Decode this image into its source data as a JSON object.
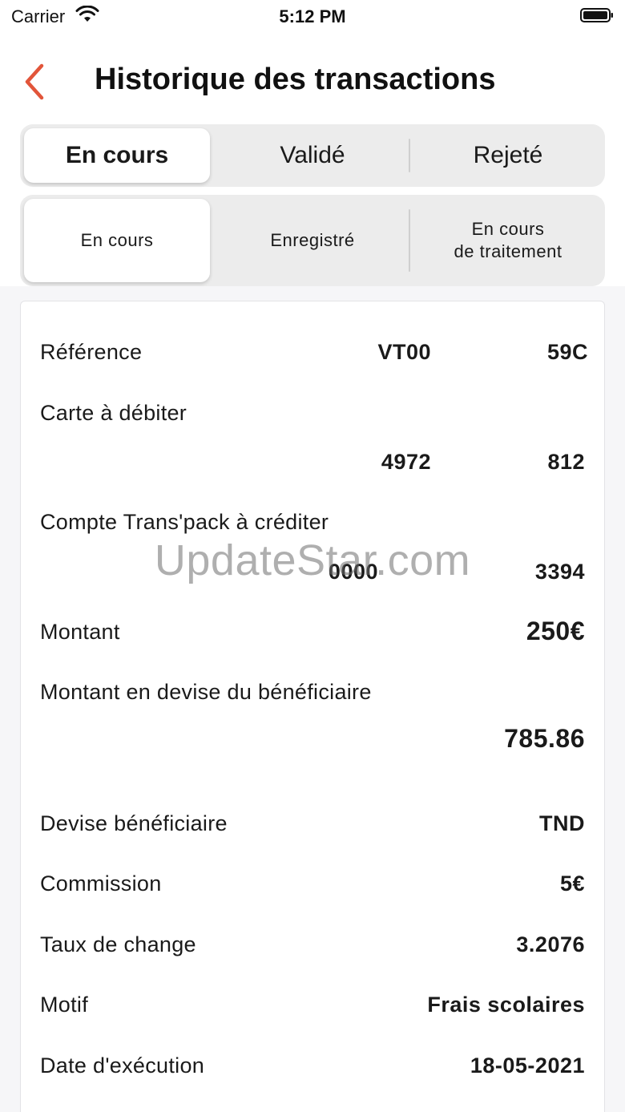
{
  "status_bar": {
    "carrier": "Carrier",
    "time": "5:12 PM",
    "icons": [
      "wifi-icon",
      "battery-icon"
    ]
  },
  "header": {
    "back_icon": "chevron-left-icon",
    "title": "Historique des transactions",
    "accent_color": "#e2553a"
  },
  "status_tabs": {
    "items": [
      "En cours",
      "Validé",
      "Rejeté"
    ],
    "selected": "En cours"
  },
  "sub_tabs": {
    "items": [
      "En cours",
      "Enregistré",
      "En cours\nde traitement"
    ],
    "selected": "En cours"
  },
  "transaction": {
    "reference": {
      "label": "Référence",
      "value_start": "VT00",
      "value_end": "59C"
    },
    "card_debit": {
      "label": "Carte à débiter",
      "value_start": "4972",
      "value_end": "812"
    },
    "account_credit": {
      "label": "Compte Trans'pack à créditer",
      "value_start": "0000",
      "value_end": "3394"
    },
    "amount": {
      "label": "Montant",
      "value": "250€"
    },
    "amount_beneficiary_currency": {
      "label": "Montant en devise du bénéficiaire",
      "value": "785.86"
    },
    "beneficiary_currency": {
      "label": "Devise bénéficiaire",
      "value": "TND"
    },
    "commission": {
      "label": "Commission",
      "value": "5€"
    },
    "exchange_rate": {
      "label": "Taux de change",
      "value": "3.2076"
    },
    "reason": {
      "label": "Motif",
      "value": "Frais scolaires"
    },
    "execution_date": {
      "label": "Date d'exécution",
      "value": "18-05-2021"
    }
  },
  "watermark": "UpdateStar.com"
}
